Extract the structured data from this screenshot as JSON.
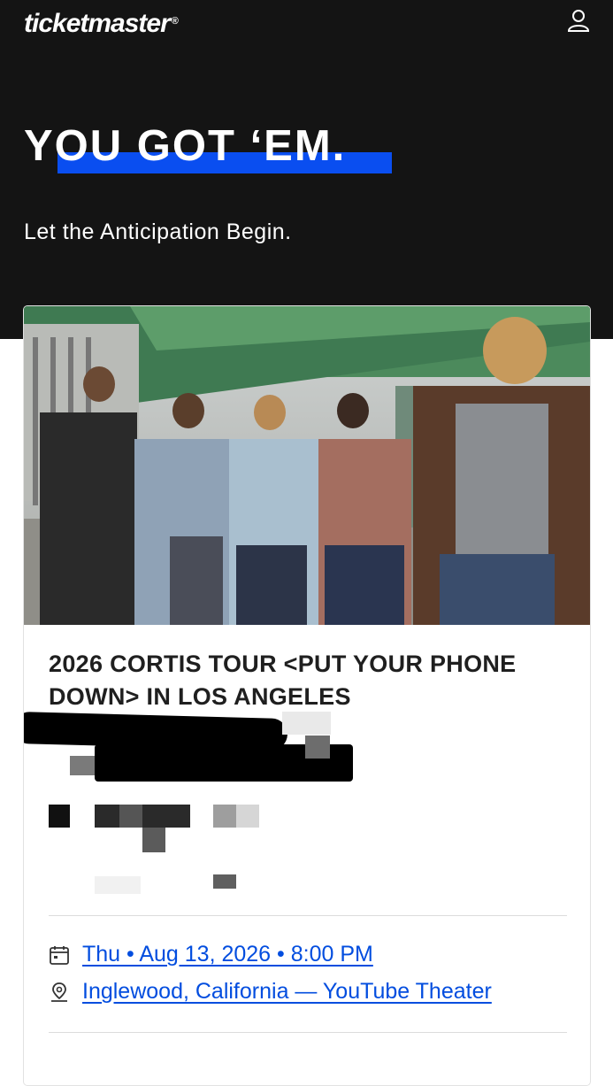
{
  "header": {
    "logo_text": "ticketmaster",
    "logo_mark": "®",
    "account_icon": "user-icon"
  },
  "hero": {
    "headline": "YOU GOT ‘EM.",
    "subheadline": "Let the Anticipation Begin.",
    "accent_color": "#0a4ef0",
    "background_color": "#141414"
  },
  "event": {
    "title": "2026 CORTIS TOUR <PUT YOUR PHONE DOWN> IN LOS ANGELES",
    "datetime": "Thu • Aug 13, 2026 • 8:00 PM",
    "location": "Inglewood, California — YouTube Theater",
    "link_color": "#024ddf",
    "calendar_icon": "calendar-icon",
    "venue_icon": "venue-icon"
  }
}
